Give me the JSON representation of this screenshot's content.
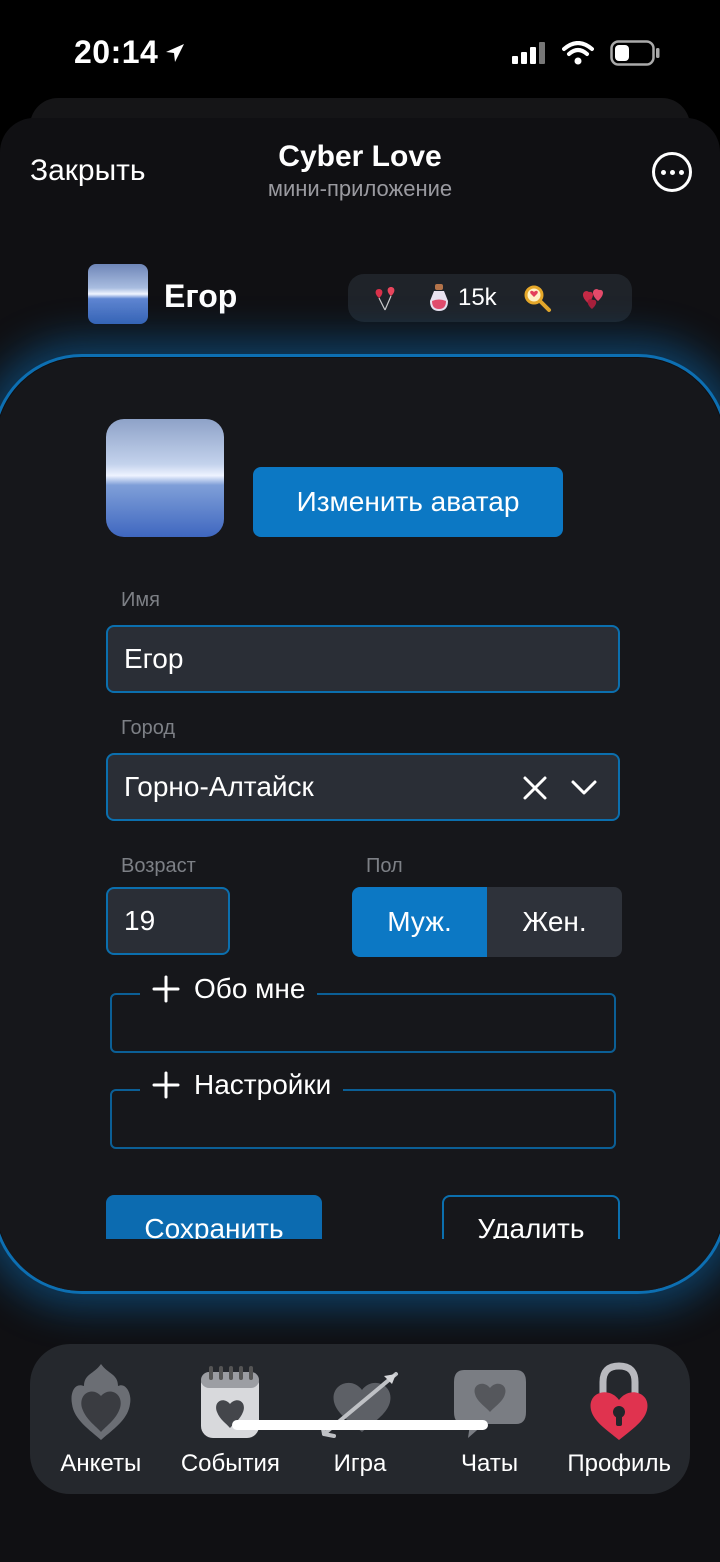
{
  "status": {
    "time": "20:14"
  },
  "header": {
    "close_label": "Закрыть",
    "title": "Cyber Love",
    "subtitle": "мини-приложение"
  },
  "user": {
    "name": "Егор",
    "stats": [
      {
        "icon": "heart-balloons-icon",
        "value": ""
      },
      {
        "icon": "potion-bottle-icon",
        "value": "15k"
      },
      {
        "icon": "magnifier-icon",
        "value": ""
      },
      {
        "icon": "hearts-icon",
        "value": ""
      }
    ]
  },
  "profile_form": {
    "change_avatar_label": "Изменить аватар",
    "name_label": "Имя",
    "name_value": "Егор",
    "city_label": "Город",
    "city_value": "Горно-Алтайск",
    "age_label": "Возраст",
    "age_value": "19",
    "gender_label": "Пол",
    "gender_options": [
      "Муж.",
      "Жен."
    ],
    "gender_selected": "Муж.",
    "about_label": "Обо мне",
    "settings_label": "Настройки",
    "save_label": "Сохранить",
    "delete_label": "Удалить"
  },
  "nav": {
    "items": [
      {
        "label": "Анкеты",
        "icon": "fire-heart-icon"
      },
      {
        "label": "События",
        "icon": "calendar-heart-icon"
      },
      {
        "label": "Игра",
        "icon": "arrow-heart-icon"
      },
      {
        "label": "Чаты",
        "icon": "chat-heart-icon"
      },
      {
        "label": "Профиль",
        "icon": "heart-lock-icon"
      }
    ],
    "active": "Профиль"
  },
  "colors": {
    "accent": "#0c78c4",
    "background": "#101013",
    "card": "#16171b",
    "field": "#2a2e36"
  }
}
